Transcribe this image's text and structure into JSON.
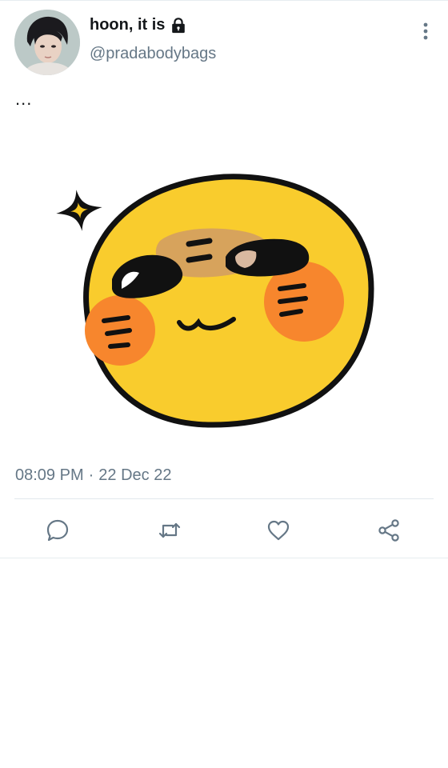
{
  "tweet": {
    "display_name": "hoon, it is",
    "handle": "@pradabodybags",
    "text": "...",
    "time": "08:09 PM",
    "separator": "·",
    "date": "22 Dec 22"
  },
  "icons": {
    "lock": "lock-icon",
    "more": "more-vertical-icon",
    "reply": "reply-icon",
    "retweet": "retweet-icon",
    "like": "heart-icon",
    "share": "share-icon"
  },
  "colors": {
    "secondary_text": "#657786",
    "icon": "#657786",
    "divider": "#e1e8ed",
    "emoji_yellow": "#f9cc2d",
    "emoji_blush": "#f7862d",
    "emoji_brow": "#d7a35c"
  }
}
